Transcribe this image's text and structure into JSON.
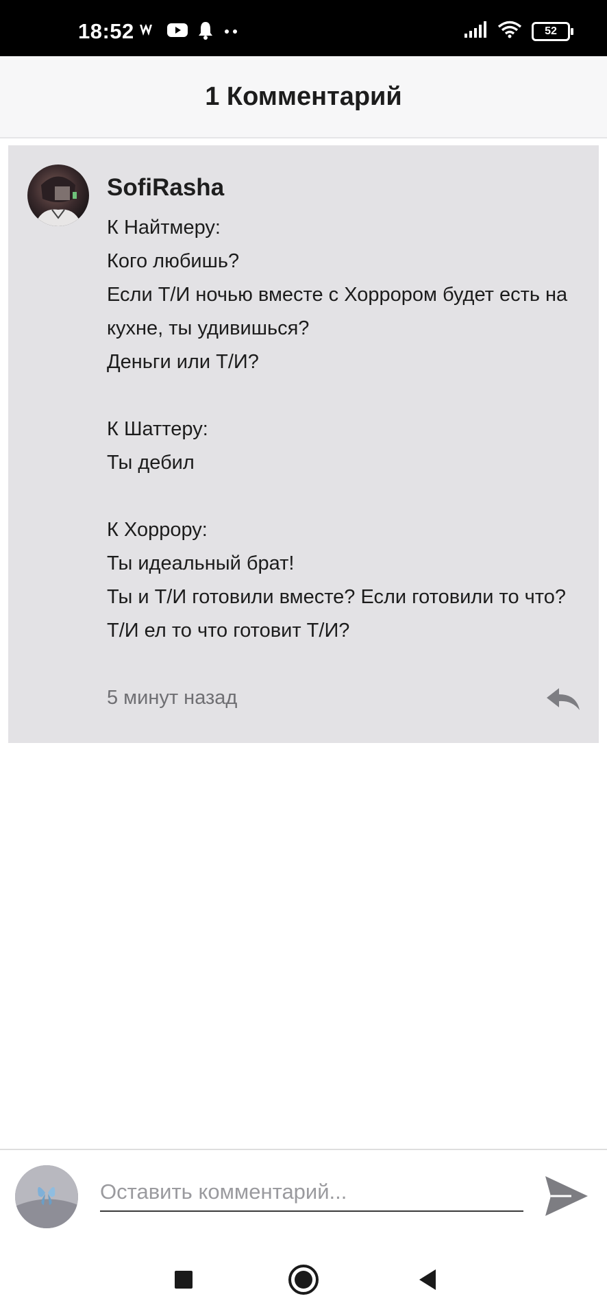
{
  "status_bar": {
    "time": "18:52",
    "battery": "52",
    "icons": [
      "wattpad-icon",
      "youtube-icon",
      "bell-icon",
      "more-dots-icon",
      "signal-icon",
      "wifi-icon",
      "battery-icon"
    ]
  },
  "header": {
    "title": "1 Комментарий"
  },
  "comment": {
    "author": "SofiRasha",
    "body": "К Найтмеру:\nКого любишь?\nЕсли Т/И ночью вместе с Хоррором будет есть на кухне, ты удивишься?\nДеньги или Т/И?\n\nК Шаттеру:\nТы дебил\n\nК Хоррору:\nТы идеальный брат!\nТы и Т/И готовили вместе? Если готовили то что?\nТ/И ел то что готовит Т/И?",
    "time": "5 минут назад",
    "reply_icon": "reply-icon"
  },
  "input": {
    "placeholder": "Оставить комментарий...",
    "value": "",
    "send_icon": "send-icon"
  },
  "nav": {
    "icons": [
      "recents-square-icon",
      "home-circle-icon",
      "back-triangle-icon"
    ]
  },
  "colors": {
    "status_bg": "#000000",
    "header_bg": "#f7f7f8",
    "card_bg": "#e3e2e5",
    "muted_text": "#6f6f73",
    "icon_gray": "#7d7d82"
  }
}
